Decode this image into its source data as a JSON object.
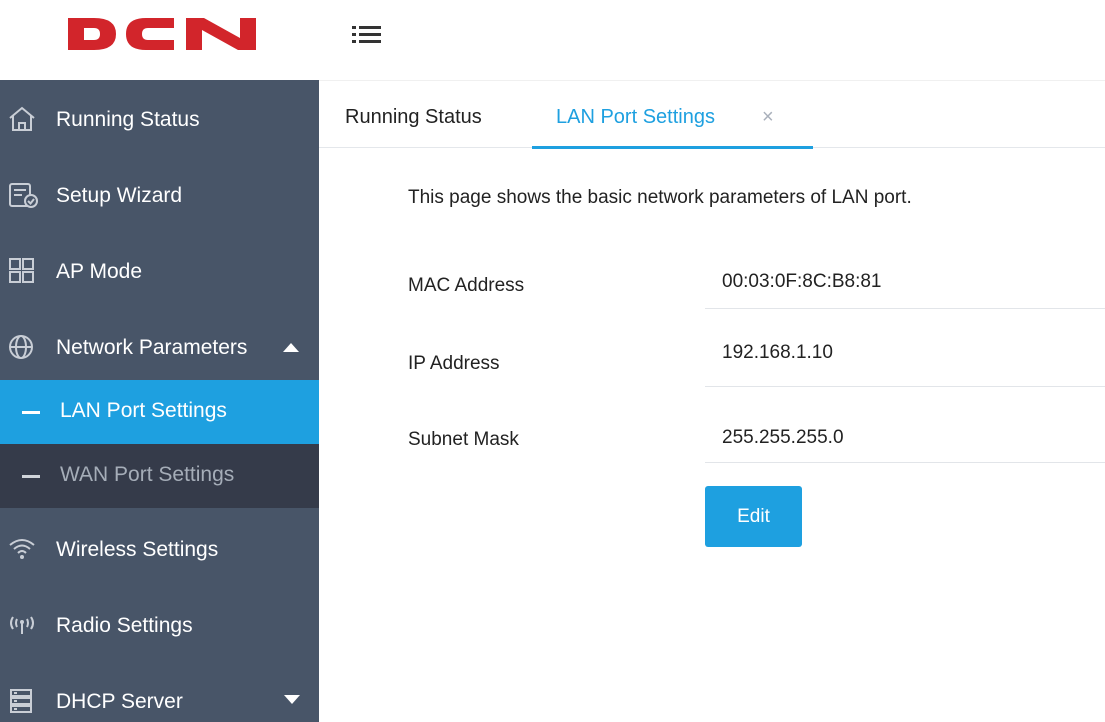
{
  "brand": {
    "logo_text": "DCN",
    "logo_color": "#d2252b"
  },
  "colors": {
    "accent": "#1ea0e0",
    "sidebar_bg": "#485568",
    "sidebar_sub_bg": "#353b4a"
  },
  "sidebar": {
    "items": [
      {
        "label": "Running Status",
        "icon": "home-icon"
      },
      {
        "label": "Setup Wizard",
        "icon": "wizard-icon"
      },
      {
        "label": "AP Mode",
        "icon": "grid-icon"
      },
      {
        "label": "Network Parameters",
        "icon": "globe-icon",
        "expanded": true
      },
      {
        "label": "Wireless Settings",
        "icon": "wifi-icon"
      },
      {
        "label": "Radio Settings",
        "icon": "antenna-icon"
      },
      {
        "label": "DHCP Server",
        "icon": "server-icon",
        "expanded": false
      }
    ],
    "subitems": [
      {
        "label": "LAN Port Settings",
        "active": true
      },
      {
        "label": "WAN Port Settings",
        "active": false
      }
    ]
  },
  "tabs": [
    {
      "label": "Running Status",
      "active": false
    },
    {
      "label": "LAN Port Settings",
      "active": true,
      "closable": true,
      "close_glyph": "×"
    }
  ],
  "content": {
    "description": "This page shows the basic network parameters of LAN port.",
    "fields": [
      {
        "label": "MAC Address",
        "value": "00:03:0F:8C:B8:81"
      },
      {
        "label": "IP Address",
        "value": "192.168.1.10"
      },
      {
        "label": "Subnet Mask",
        "value": "255.255.255.0"
      }
    ],
    "edit_label": "Edit"
  }
}
